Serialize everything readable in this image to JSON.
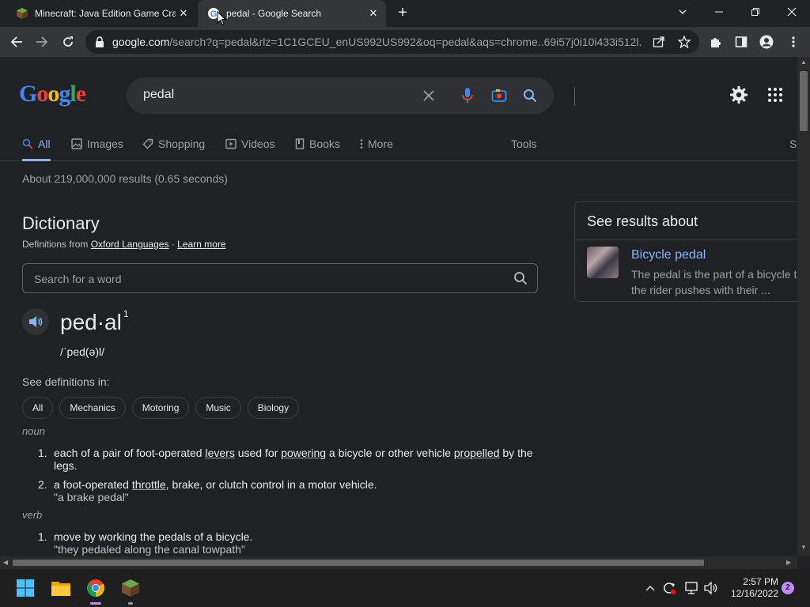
{
  "browser": {
    "tabs": [
      {
        "title": "Minecraft: Java Edition Game Cra",
        "active": false
      },
      {
        "title": "pedal - Google Search",
        "active": true
      }
    ],
    "url_host": "google.com",
    "url_rest": "/search?q=pedal&rlz=1C1GCEU_enUS992US992&oq=pedal&aqs=chrome..69i57j0i10i433i512l..."
  },
  "search": {
    "query": "pedal",
    "tabs": [
      "All",
      "Images",
      "Shopping",
      "Videos",
      "Books",
      "More"
    ],
    "tools_label": "Tools",
    "cut_tab": "S",
    "stats": "About 219,000,000 results (0.65 seconds)"
  },
  "dictionary": {
    "title": "Dictionary",
    "definitions_from": "Definitions from",
    "source": "Oxford Languages",
    "separator": "·",
    "learn_more": "Learn more",
    "search_placeholder": "Search for a word",
    "headword": "ped·al",
    "superscript": "1",
    "phonetic": "/ˈped(ə)l/",
    "see_definitions": "See definitions in:",
    "chips": [
      "All",
      "Mechanics",
      "Motoring",
      "Music",
      "Biology"
    ],
    "noun_label": "noun",
    "verb_label": "verb",
    "noun_defs": [
      {
        "num": "1.",
        "parts": [
          "each of a pair of foot-operated ",
          "levers",
          " used for ",
          "powering",
          " a bicycle or other vehicle ",
          "propelled",
          " by the legs."
        ]
      },
      {
        "num": "2.",
        "parts": [
          "a foot-operated ",
          "throttle",
          ", brake, or clutch control in a motor vehicle."
        ],
        "example": "\"a brake pedal\""
      }
    ],
    "verb_defs": [
      {
        "num": "1.",
        "text": "move by working the pedals of a bicycle.",
        "example": "\"they pedaled along the canal towpath\""
      }
    ]
  },
  "knowledge_panel": {
    "header": "See results about",
    "title": "Bicycle pedal",
    "description_line1": "The pedal is the part of a bicycle t",
    "description_line2": "the rider pushes with their ..."
  },
  "taskbar": {
    "time": "2:57 PM",
    "date": "12/16/2022",
    "notifications": "2"
  },
  "colors": {
    "accent": "#8ab4f8",
    "background": "#202124",
    "panel": "#303134"
  }
}
